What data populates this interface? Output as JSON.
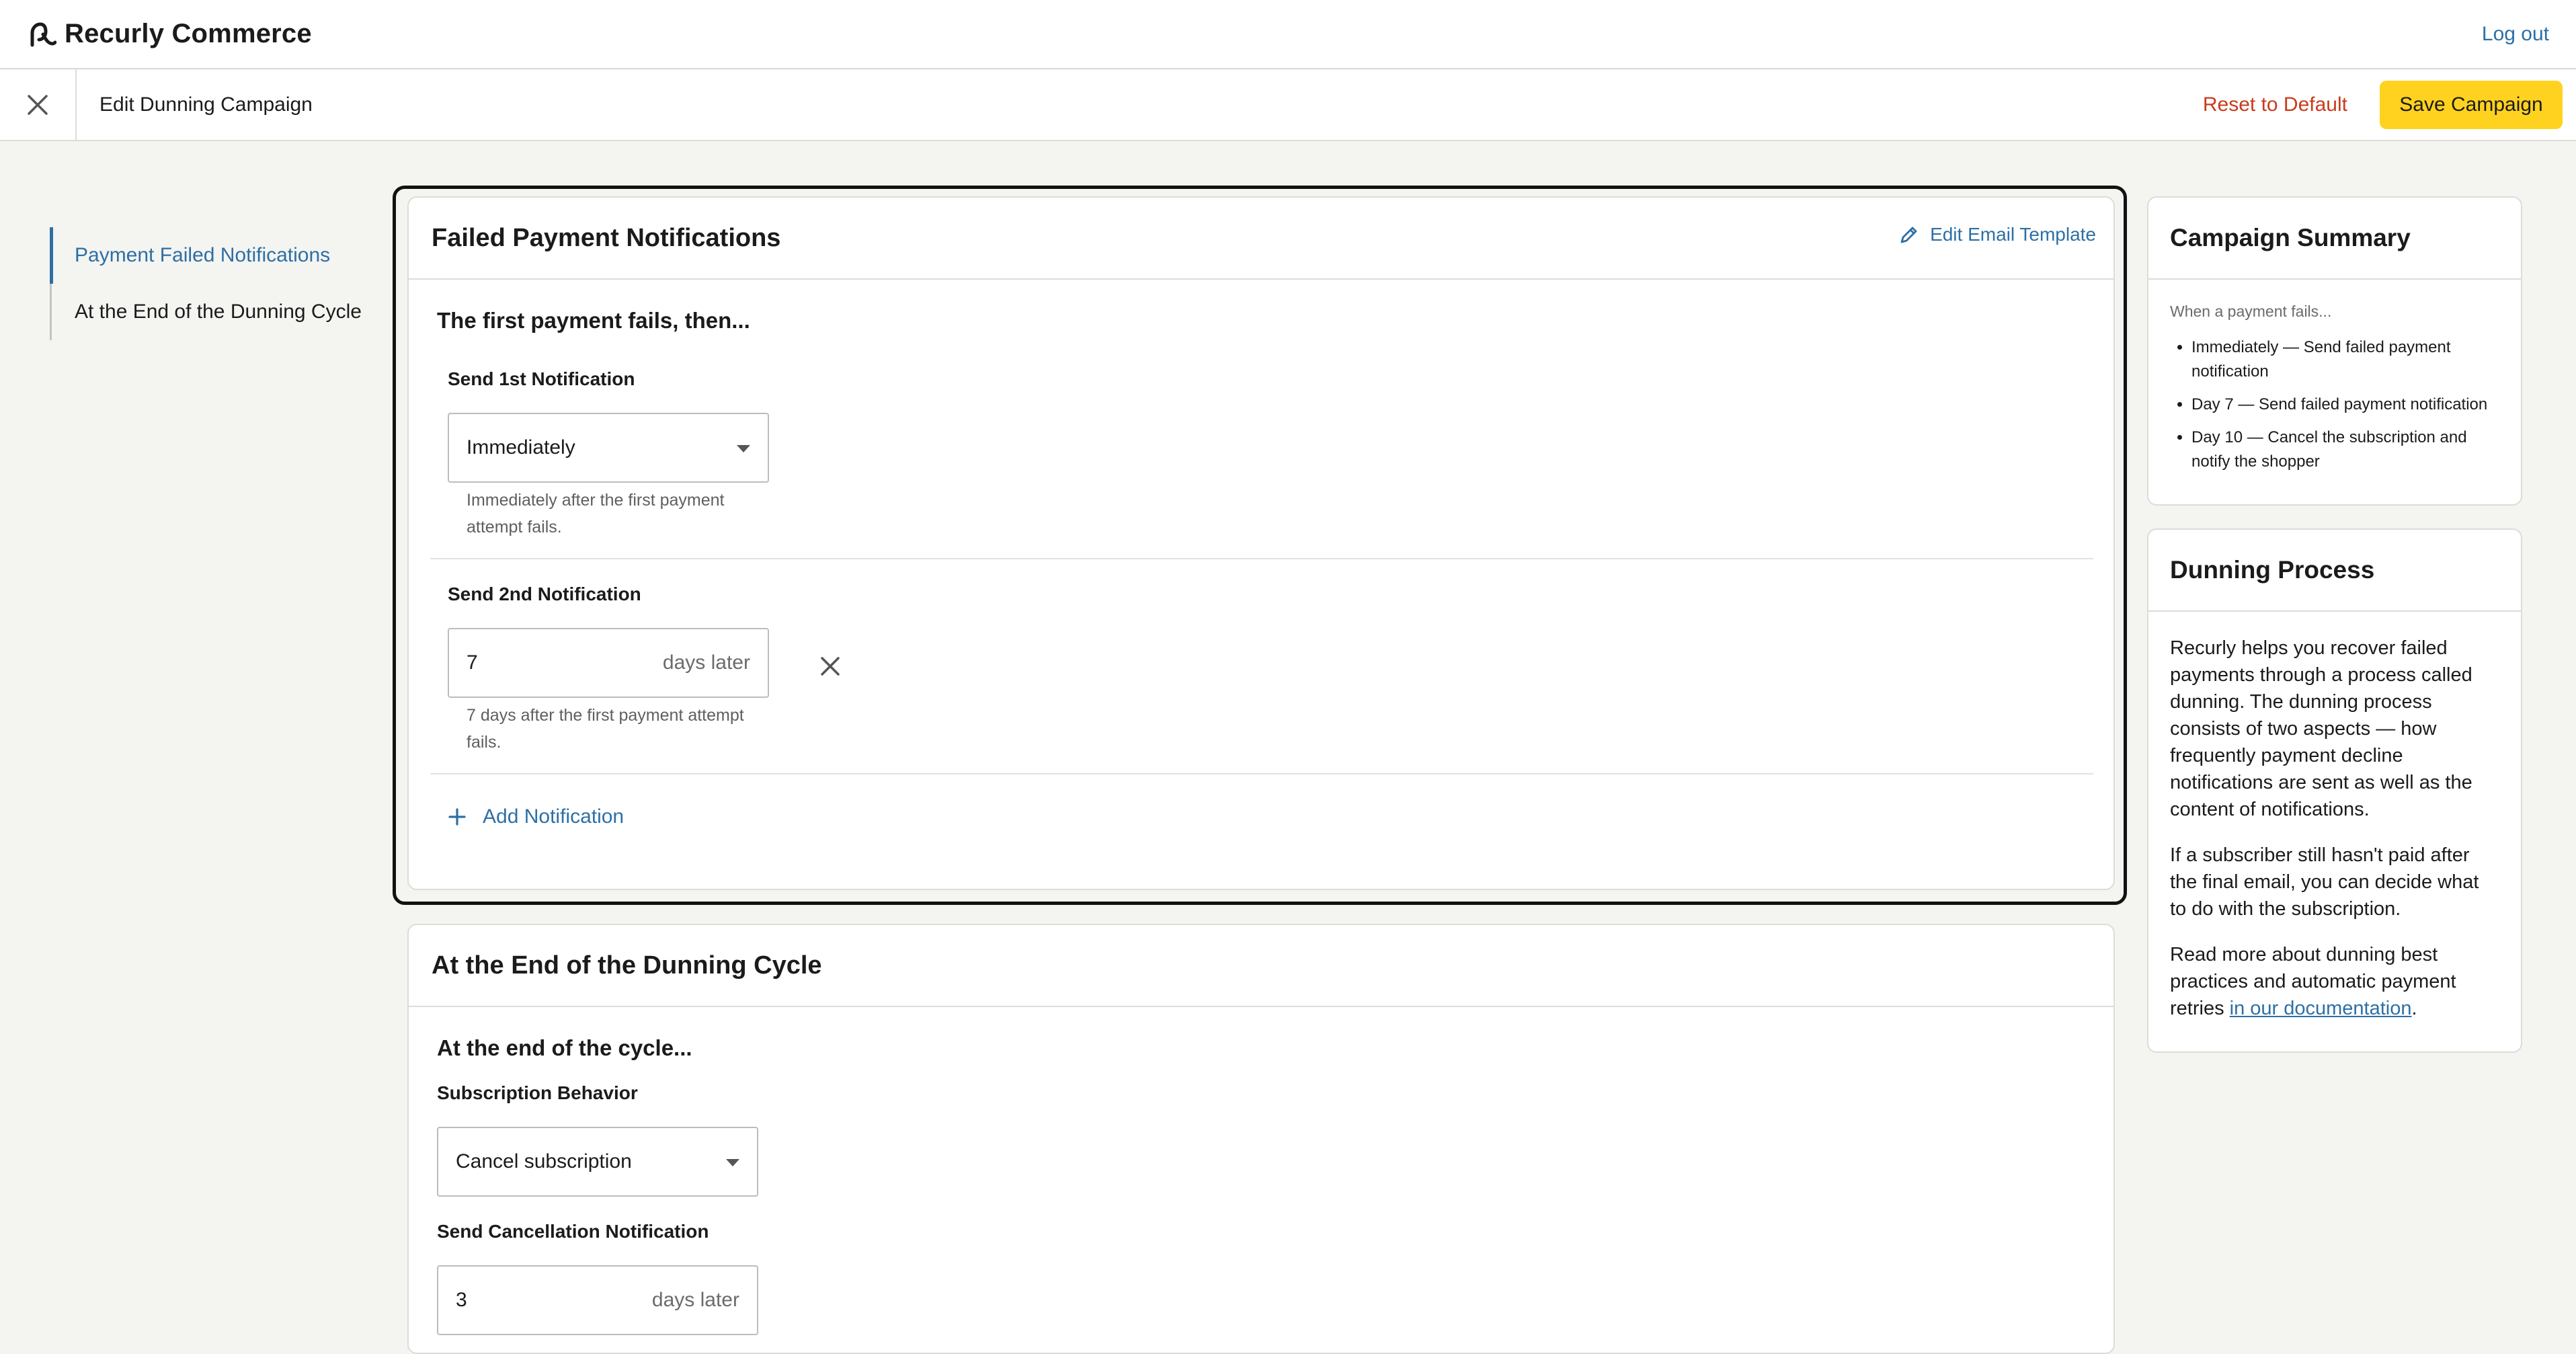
{
  "topbar": {
    "brand": "Recurly Commerce",
    "logout": "Log out"
  },
  "subheader": {
    "title": "Edit Dunning Campaign",
    "reset": "Reset to Default",
    "save": "Save Campaign"
  },
  "nav": {
    "items": [
      {
        "label": "Payment Failed Notifications",
        "active": true
      },
      {
        "label": "At the End of the Dunning Cycle",
        "active": false
      }
    ]
  },
  "failed": {
    "title": "Failed Payment Notifications",
    "edit_template": "Edit Email Template",
    "lead": "The first payment fails, then...",
    "n1": {
      "label": "Send 1st Notification",
      "value": "Immediately",
      "helper": "Immediately after the first payment attempt fails."
    },
    "n2": {
      "label": "Send 2nd Notification",
      "value": "7",
      "suffix": "days later",
      "helper": "7 days after the first payment attempt fails."
    },
    "add": "Add Notification"
  },
  "end": {
    "title": "At the End of the Dunning Cycle",
    "lead": "At the end of the cycle...",
    "behavior_label": "Subscription Behavior",
    "behavior_value": "Cancel subscription",
    "cancel_label": "Send Cancellation Notification",
    "cancel_value": "3",
    "cancel_suffix": "days later"
  },
  "summary": {
    "title": "Campaign Summary",
    "intro": "When a payment fails...",
    "items": [
      "Immediately — Send failed payment notification",
      "Day 7 — Send failed payment notification",
      "Day 10 — Cancel the subscription and notify the shopper"
    ]
  },
  "process": {
    "title": "Dunning Process",
    "p1": "Recurly helps you recover failed payments through a process called dunning. The dunning process consists of two aspects — how frequently payment decline notifications are sent as well as the content of notifications.",
    "p2": "If a subscriber still hasn't paid after the final email, you can decide what to do with the subscription.",
    "p3_prefix": "Read more about dunning best practices and automatic payment retries ",
    "p3_link": "in our documentation",
    "p3_suffix": "."
  },
  "colors": {
    "accent": "#2d6fa5",
    "danger": "#c93b1c",
    "primary_button": "#ffd21f",
    "background": "#f4f4f1"
  }
}
